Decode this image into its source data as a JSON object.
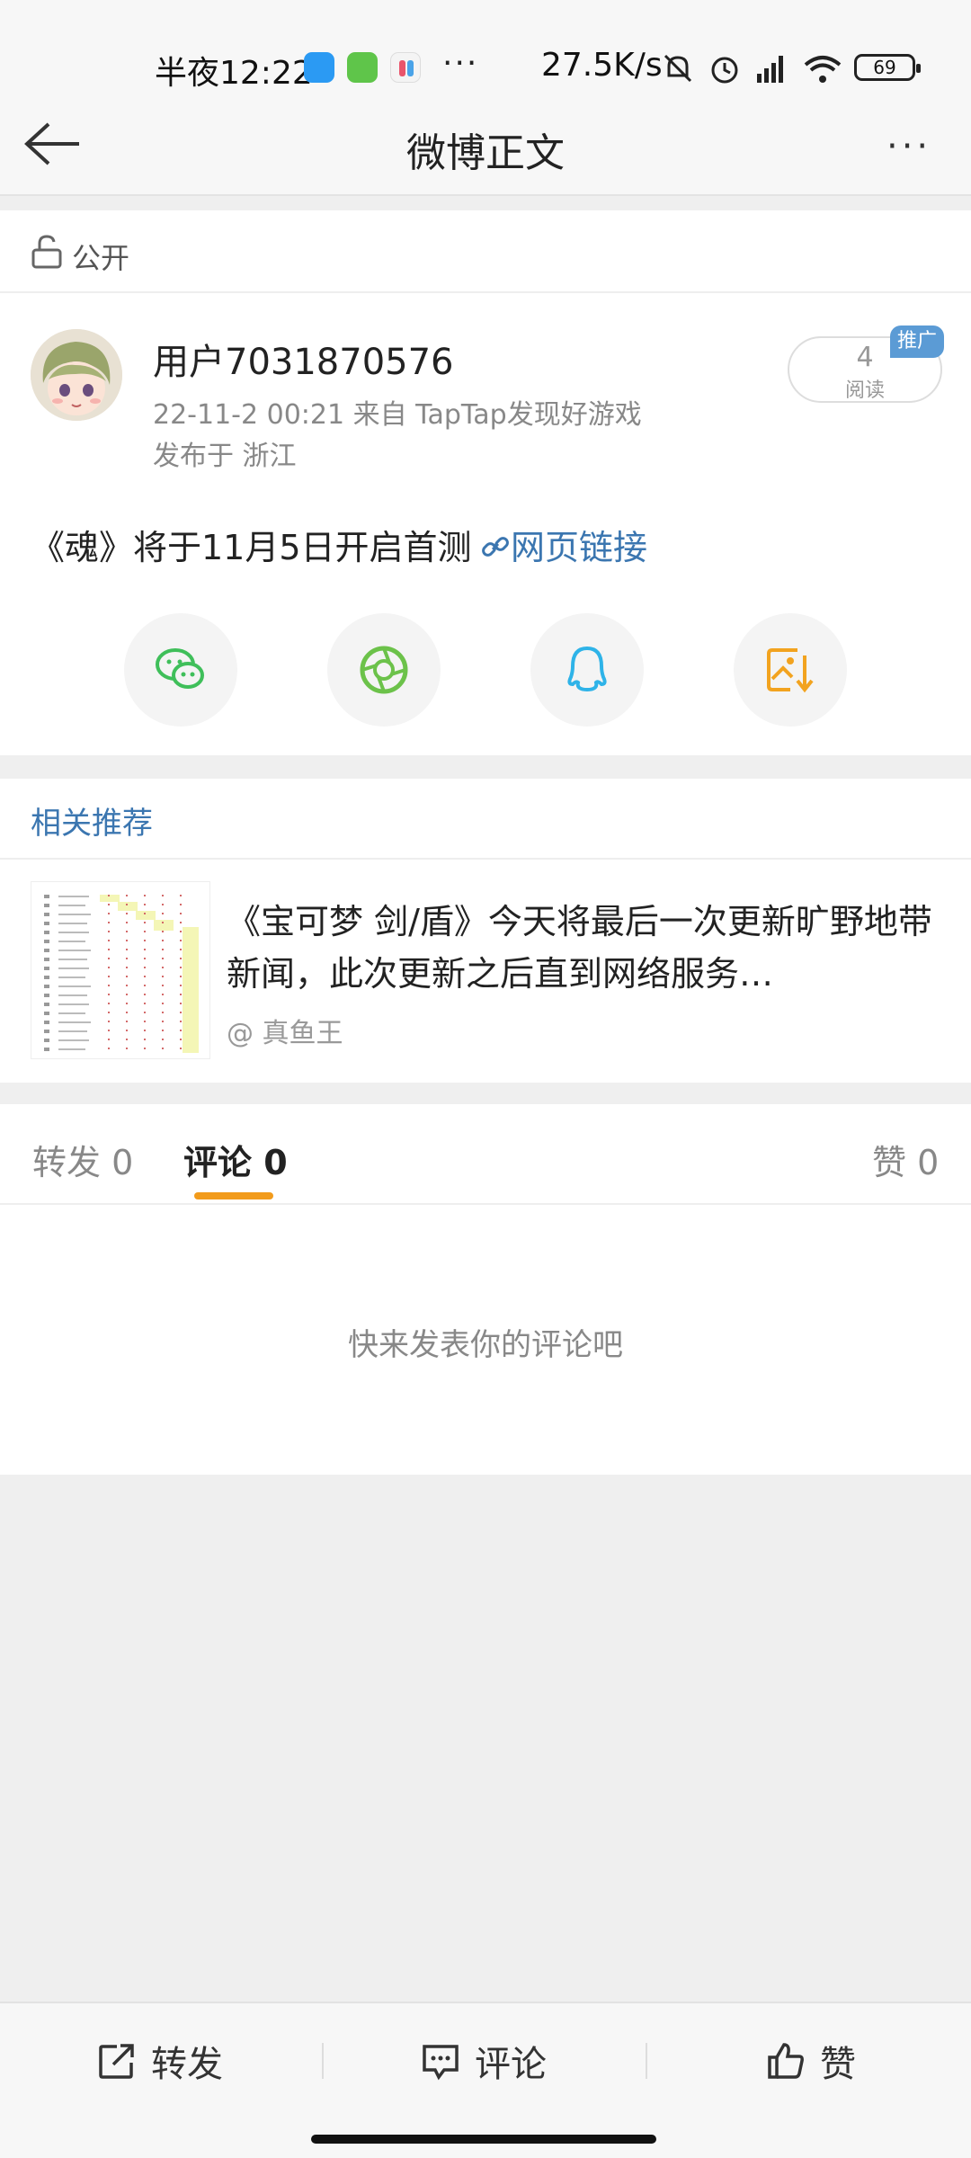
{
  "status_bar": {
    "time": "半夜12:22",
    "more": "···",
    "net_speed": "27.5K/s",
    "battery": "69"
  },
  "nav": {
    "title": "微博正文",
    "more": "···"
  },
  "post": {
    "visibility": "公开",
    "username": "用户7031870576",
    "meta": "22-11-2 00:21   来自 TapTap发现好游戏",
    "location": "发布于 浙江",
    "read_count": "4",
    "read_label": "阅读",
    "promo_badge": "推广",
    "text": "《魂》将于11月5日开启首测",
    "link_text": "网页链接"
  },
  "share_icons": [
    "wechat-icon",
    "moments-icon",
    "qq-icon",
    "save-image-icon"
  ],
  "related": {
    "title": "相关推荐",
    "item_text": "《宝可梦 剑/盾》今天将最后一次更新旷野地带新闻，此次更新之后直到网络服务…",
    "author": "@ 真鱼王"
  },
  "tabs": {
    "repost": "转发 0",
    "comment": "评论 0",
    "like": "赞 0"
  },
  "comments": {
    "empty": "快来发表你的评论吧"
  },
  "bottom_bar": {
    "repost": "转发",
    "comment": "评论",
    "like": "赞"
  },
  "colors": {
    "link_blue": "#3b76b0",
    "tab_accent": "#f29b1b",
    "badge_blue": "#5b9bd5"
  }
}
